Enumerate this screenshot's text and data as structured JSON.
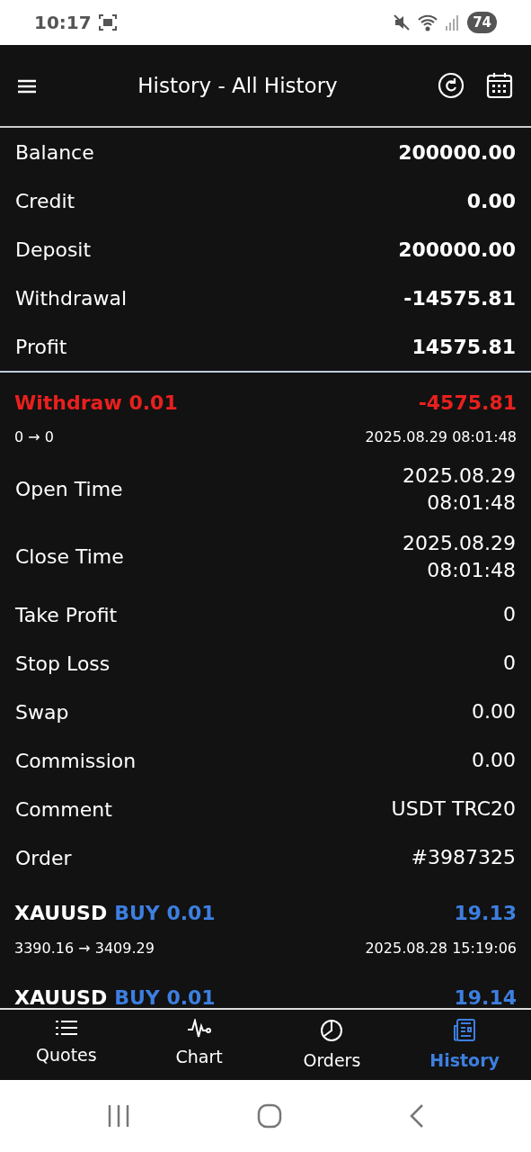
{
  "status_bar": {
    "time": "10:17",
    "battery": "74"
  },
  "app_bar": {
    "title": "History - All History"
  },
  "summary": [
    {
      "label": "Balance",
      "value": "200000.00"
    },
    {
      "label": "Credit",
      "value": "0.00"
    },
    {
      "label": "Deposit",
      "value": "200000.00"
    },
    {
      "label": "Withdrawal",
      "value": "-14575.81"
    },
    {
      "label": "Profit",
      "value": "14575.81"
    }
  ],
  "deals": [
    {
      "kind": "balance",
      "title": "Withdraw 0.01",
      "amount": "-4575.81",
      "prices": "0 → 0",
      "time": "2025.08.29 08:01:48",
      "details": [
        {
          "label": "Open Time",
          "value": "2025.08.29 08:01:48"
        },
        {
          "label": "Close Time",
          "value": "2025.08.29 08:01:48"
        },
        {
          "label": "Take Profit",
          "value": "0"
        },
        {
          "label": "Stop Loss",
          "value": "0"
        },
        {
          "label": "Swap",
          "value": "0.00"
        },
        {
          "label": "Commission",
          "value": "0.00"
        },
        {
          "label": "Comment",
          "value": "USDT TRC20"
        },
        {
          "label": "Order",
          "value": "#3987325"
        }
      ]
    },
    {
      "kind": "trade",
      "symbol": "XAUUSD",
      "side": "BUY 0.01",
      "amount": "19.13",
      "prices": "3390.16 → 3409.29",
      "time": "2025.08.28 15:19:06"
    },
    {
      "kind": "trade",
      "symbol": "XAUUSD",
      "side": "BUY 0.01",
      "amount": "19.14"
    }
  ],
  "bottom_nav": [
    {
      "label": "Quotes",
      "selected": false
    },
    {
      "label": "Chart",
      "selected": false
    },
    {
      "label": "Orders",
      "selected": false
    },
    {
      "label": "History",
      "selected": true
    }
  ]
}
